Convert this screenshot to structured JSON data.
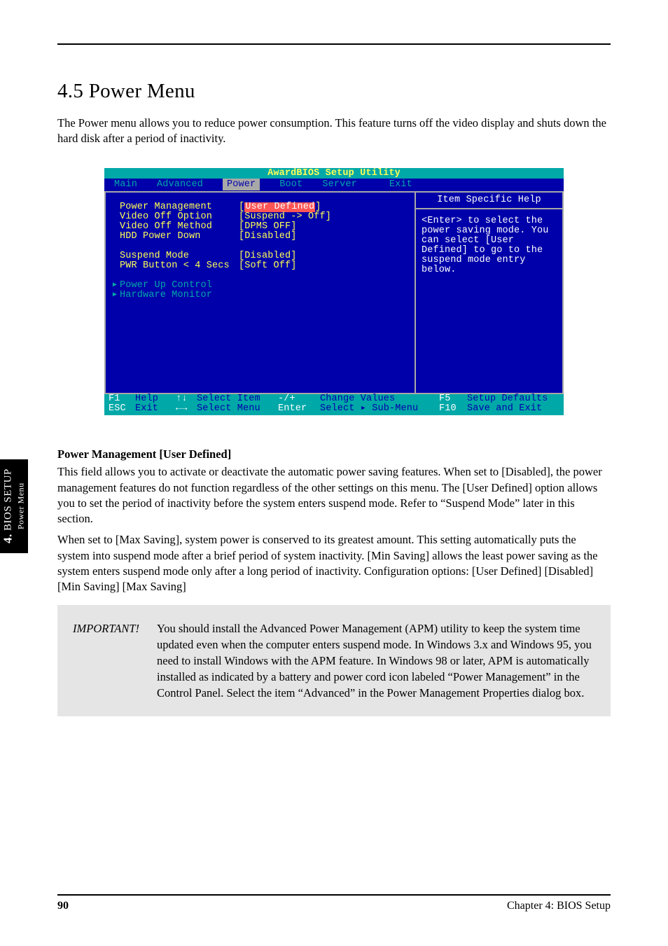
{
  "section_heading": "4.5 Power Menu",
  "intro": "The Power menu allows you to reduce power consumption. This feature turns off the video display and shuts down the hard disk after a period of inactivity.",
  "bios": {
    "title": "AwardBIOS Setup Utility",
    "menu": [
      "Main",
      "Advanced",
      "Power",
      "Boot",
      "Server",
      "Exit"
    ],
    "menu_selected": "Power",
    "items": [
      {
        "label": "Power Management",
        "value": "[User Defined]",
        "selected": true
      },
      {
        "label": "Video Off Option",
        "value": "[Suspend -> Off]"
      },
      {
        "label": "Video Off Method",
        "value": "[DPMS OFF]"
      },
      {
        "label": "HDD Power Down",
        "value": "[Disabled]"
      }
    ],
    "items2": [
      {
        "label": "Suspend Mode",
        "value": "[Disabled]"
      },
      {
        "label": "PWR Button < 4 Secs",
        "value": "[Soft Off]"
      }
    ],
    "subitems": [
      {
        "label": "Power Up Control"
      },
      {
        "label": "Hardware Monitor"
      }
    ],
    "help_title": "Item Specific Help",
    "help_body": "<Enter> to select the power saving mode. You can select [User Defined] to go to the suspend mode entry below.",
    "footer": {
      "r1": {
        "k1": "F1",
        "t1": "Help",
        "a1": "↑↓",
        "t2": "Select Item",
        "k2": "-/+",
        "t3": "Change Values",
        "k3": "F5",
        "t4": "Setup Defaults"
      },
      "r2": {
        "k1": "ESC",
        "t1": "Exit",
        "a1": "←→",
        "t2": "Select Menu",
        "k2": "Enter",
        "t3": "Select ▸ Sub-Menu",
        "k3": "F10",
        "t4": "Save and Exit"
      }
    }
  },
  "option": {
    "title": "Power Management [User Defined]",
    "body": "This field allows you to activate or deactivate the automatic power saving features. When set to [Disabled], the power management features do not function regardless of the other settings on this menu. The [User Defined] option allows you to set the period of inactivity before the system enters suspend mode. Refer to “Suspend Mode” later in this section.",
    "body2": "When set to [Max Saving], system power is conserved to its greatest amount. This setting automatically puts the system into suspend mode after a brief period of system inactivity. [Min Saving] allows the least power saving as the system enters suspend mode only after a long period of inactivity. Configuration options: [User Defined] [Disabled] [Min Saving] [Max Saving]"
  },
  "notes": [
    {
      "label": "IMPORTANT!",
      "text": "You should install the Advanced Power Management (APM) utility to keep the system time updated even when the computer enters suspend mode. In Windows 3.x and Windows 95, you need to install Windows with the APM feature. In Windows 98 or later, APM is automatically installed as indicated by a battery and power cord icon labeled “Power Management” in the Control Panel. Select the item “Advanced” in the Power Management Properties dialog box."
    }
  ],
  "footer": {
    "left_num": "90",
    "left_text": "Chapter 4: BIOS Setup",
    "right": ""
  },
  "side_tab": {
    "num": "4.",
    "text": "BIOS SETUP",
    "sub": "Power Menu"
  }
}
